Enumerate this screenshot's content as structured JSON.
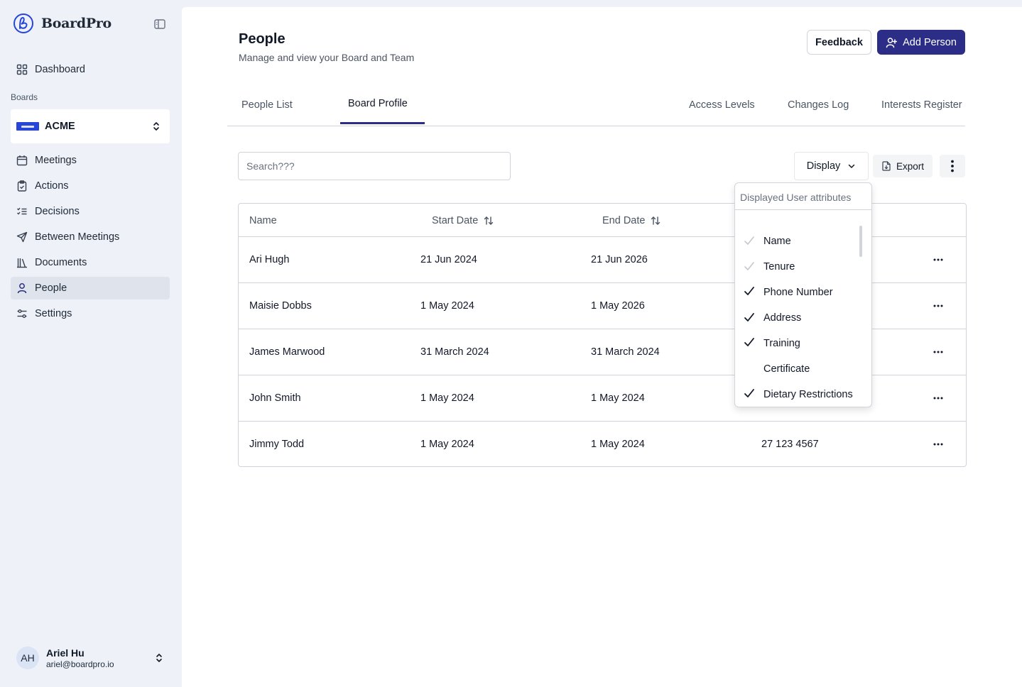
{
  "app": {
    "brand": "BoardPro",
    "brand_color": "#2b2d87"
  },
  "sidebar": {
    "dashboard": "Dashboard",
    "boards_label": "Boards",
    "board_name": "ACME",
    "items": [
      {
        "label": "Meetings",
        "icon": "calendar-icon"
      },
      {
        "label": "Actions",
        "icon": "clipboard-icon"
      },
      {
        "label": "Decisions",
        "icon": "checklist-icon"
      },
      {
        "label": "Between Meetings",
        "icon": "send-icon"
      },
      {
        "label": "Documents",
        "icon": "library-icon"
      },
      {
        "label": "People",
        "icon": "user-icon",
        "active": true
      },
      {
        "label": "Settings",
        "icon": "sliders-icon"
      }
    ],
    "user": {
      "initials": "AH",
      "name": "Ariel Hu",
      "email": "ariel@boardpro.io"
    }
  },
  "header": {
    "title": "People",
    "subtitle": "Manage and view your Board and Team",
    "feedback_label": "Feedback",
    "add_person_label": "Add Person"
  },
  "tabs": [
    {
      "label": "People List",
      "active": false
    },
    {
      "label": "Board Profile",
      "active": true
    },
    {
      "label": "Access Levels",
      "active": false
    },
    {
      "label": "Changes Log",
      "active": false
    },
    {
      "label": "Interests Register",
      "active": false
    }
  ],
  "toolbar": {
    "search_placeholder": "Search???",
    "display_label": "Display",
    "export_label": "Export"
  },
  "table": {
    "columns": [
      "Name",
      "Start Date",
      "End Date"
    ],
    "rows": [
      {
        "name": "Ari Hugh",
        "start": "21 Jun 2024",
        "end": "21 Jun 2026",
        "phone": ""
      },
      {
        "name": "Maisie Dobbs",
        "start": "1 May 2024",
        "end": "1 May 2026",
        "phone": ""
      },
      {
        "name": "James Marwood",
        "start": "31 March 2024",
        "end": "31 March 2024",
        "phone": ""
      },
      {
        "name": "John Smith",
        "start": "1 May 2024",
        "end": "1 May 2024",
        "phone": ""
      },
      {
        "name": "Jimmy Todd",
        "start": "1 May 2024",
        "end": "1 May 2024",
        "phone": "27 123 4567"
      }
    ]
  },
  "display_menu": {
    "header": "Displayed User attributes",
    "options": [
      {
        "label": "Name",
        "state": "locked"
      },
      {
        "label": "Tenure",
        "state": "locked"
      },
      {
        "label": "Phone Number",
        "state": "checked"
      },
      {
        "label": "Address",
        "state": "checked"
      },
      {
        "label": "Training",
        "state": "checked"
      },
      {
        "label": "Certificate",
        "state": "unchecked"
      },
      {
        "label": "Dietary Restrictions",
        "state": "checked"
      }
    ]
  }
}
